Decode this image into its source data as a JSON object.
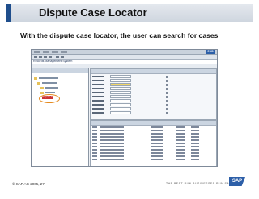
{
  "slide": {
    "title": "Dispute Case Locator",
    "subtitle": "With the dispute case locator, the user can search for cases",
    "copyright": "© SAP AG 2005, 27",
    "tagline": "THE BEST-RUN BUSINESSES RUN SAP",
    "logo": "SAP"
  },
  "app": {
    "title": "Records Management System",
    "logo": "SAP",
    "highlighted_item": "Dispute Case"
  },
  "colors": {
    "title_accent": "#1f4e8c",
    "highlight_ring": "#e58a1f",
    "field_highlight": "#f2d768",
    "sap_blue": "#2d5fa8"
  }
}
